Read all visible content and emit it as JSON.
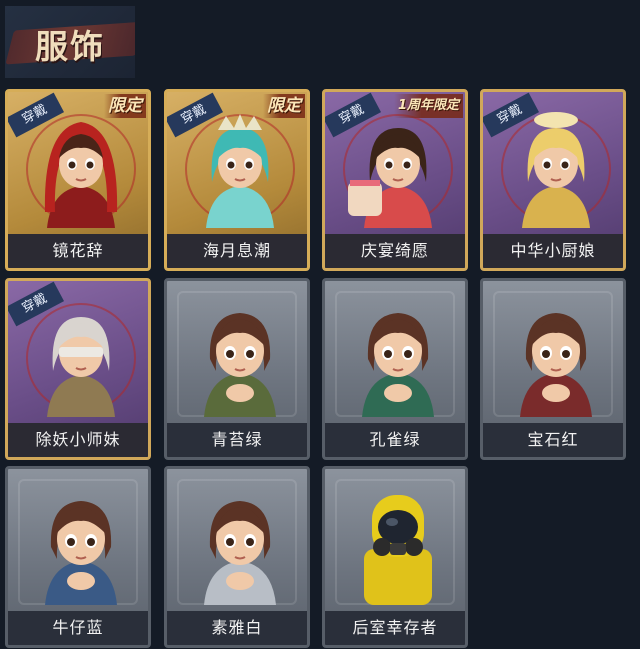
{
  "section": {
    "title": "服饰"
  },
  "badges": {
    "wear": "穿戴",
    "limited": "限定",
    "anniversary_limited": "1周年限定"
  },
  "colors": {
    "gold_frame": "#d6ad58",
    "purple_frame": "#6a4e88",
    "gray_frame": "#575e68",
    "label_bg": "#2a2f3a",
    "wear_tag": "#26395c"
  },
  "costumes": [
    {
      "name": "镜花辞",
      "rarity": "gold",
      "worn": true,
      "badge": "限定",
      "icon": "red-hood-girl-portrait-icon"
    },
    {
      "name": "海月息潮",
      "rarity": "gold",
      "worn": true,
      "badge": "限定",
      "icon": "teal-crown-girl-portrait-icon"
    },
    {
      "name": "庆宴绮愿",
      "rarity": "purple",
      "worn": true,
      "badge": "1周年限定",
      "icon": "cake-boy-portrait-icon"
    },
    {
      "name": "中华小厨娘",
      "rarity": "purple",
      "worn": true,
      "badge": "",
      "icon": "blonde-chef-portrait-icon"
    },
    {
      "name": "除妖小师妹",
      "rarity": "purple",
      "worn": true,
      "badge": "",
      "icon": "blindfold-girl-portrait-icon"
    },
    {
      "name": "青苔绿",
      "rarity": "gray",
      "worn": false,
      "badge": "",
      "icon": "girl-green-outfit-portrait-icon"
    },
    {
      "name": "孔雀绿",
      "rarity": "gray",
      "worn": false,
      "badge": "",
      "icon": "girl-teal-outfit-portrait-icon"
    },
    {
      "name": "宝石红",
      "rarity": "gray",
      "worn": false,
      "badge": "",
      "icon": "girl-red-outfit-portrait-icon"
    },
    {
      "name": "牛仔蓝",
      "rarity": "gray",
      "worn": false,
      "badge": "",
      "icon": "girl-blue-outfit-portrait-icon"
    },
    {
      "name": "素雅白",
      "rarity": "gray",
      "worn": false,
      "badge": "",
      "icon": "girl-white-outfit-portrait-icon"
    },
    {
      "name": "后室幸存者",
      "rarity": "gray",
      "worn": false,
      "badge": "",
      "icon": "hazmat-survivor-portrait-icon"
    }
  ]
}
